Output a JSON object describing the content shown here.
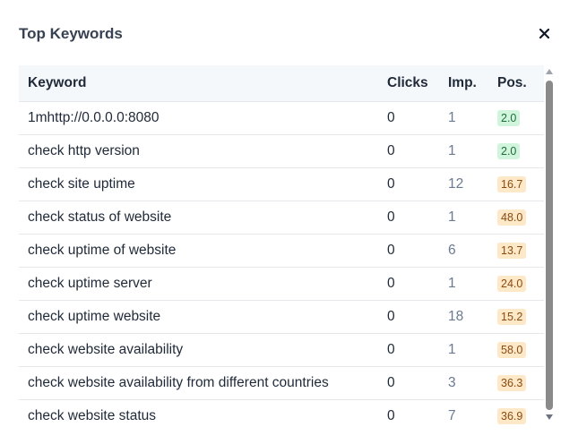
{
  "modal": {
    "title": "Top Keywords",
    "close_icon": "close-icon"
  },
  "table": {
    "headers": {
      "keyword": "Keyword",
      "clicks": "Clicks",
      "impressions": "Imp.",
      "position": "Pos."
    },
    "rows": [
      {
        "keyword": "1mhttp://0.0.0.0:8080",
        "clicks": "0",
        "impressions": "1",
        "position": "2.0",
        "pos_status": "good"
      },
      {
        "keyword": "check http version",
        "clicks": "0",
        "impressions": "1",
        "position": "2.0",
        "pos_status": "good"
      },
      {
        "keyword": "check site uptime",
        "clicks": "0",
        "impressions": "12",
        "position": "16.7",
        "pos_status": "warn"
      },
      {
        "keyword": "check status of website",
        "clicks": "0",
        "impressions": "1",
        "position": "48.0",
        "pos_status": "warn"
      },
      {
        "keyword": "check uptime of website",
        "clicks": "0",
        "impressions": "6",
        "position": "13.7",
        "pos_status": "warn"
      },
      {
        "keyword": "check uptime server",
        "clicks": "0",
        "impressions": "1",
        "position": "24.0",
        "pos_status": "warn"
      },
      {
        "keyword": "check uptime website",
        "clicks": "0",
        "impressions": "18",
        "position": "15.2",
        "pos_status": "warn"
      },
      {
        "keyword": "check website availability",
        "clicks": "0",
        "impressions": "1",
        "position": "58.0",
        "pos_status": "warn"
      },
      {
        "keyword": "check website availability from different countries",
        "clicks": "0",
        "impressions": "3",
        "position": "36.3",
        "pos_status": "warn"
      },
      {
        "keyword": "check website status",
        "clicks": "0",
        "impressions": "7",
        "position": "36.9",
        "pos_status": "warn"
      }
    ]
  },
  "colors": {
    "good_badge_bg": "#d1f5dc",
    "warn_badge_bg": "#fde8c8",
    "impressions_text": "#6b7a90",
    "header_bg": "#f5f8fb"
  }
}
